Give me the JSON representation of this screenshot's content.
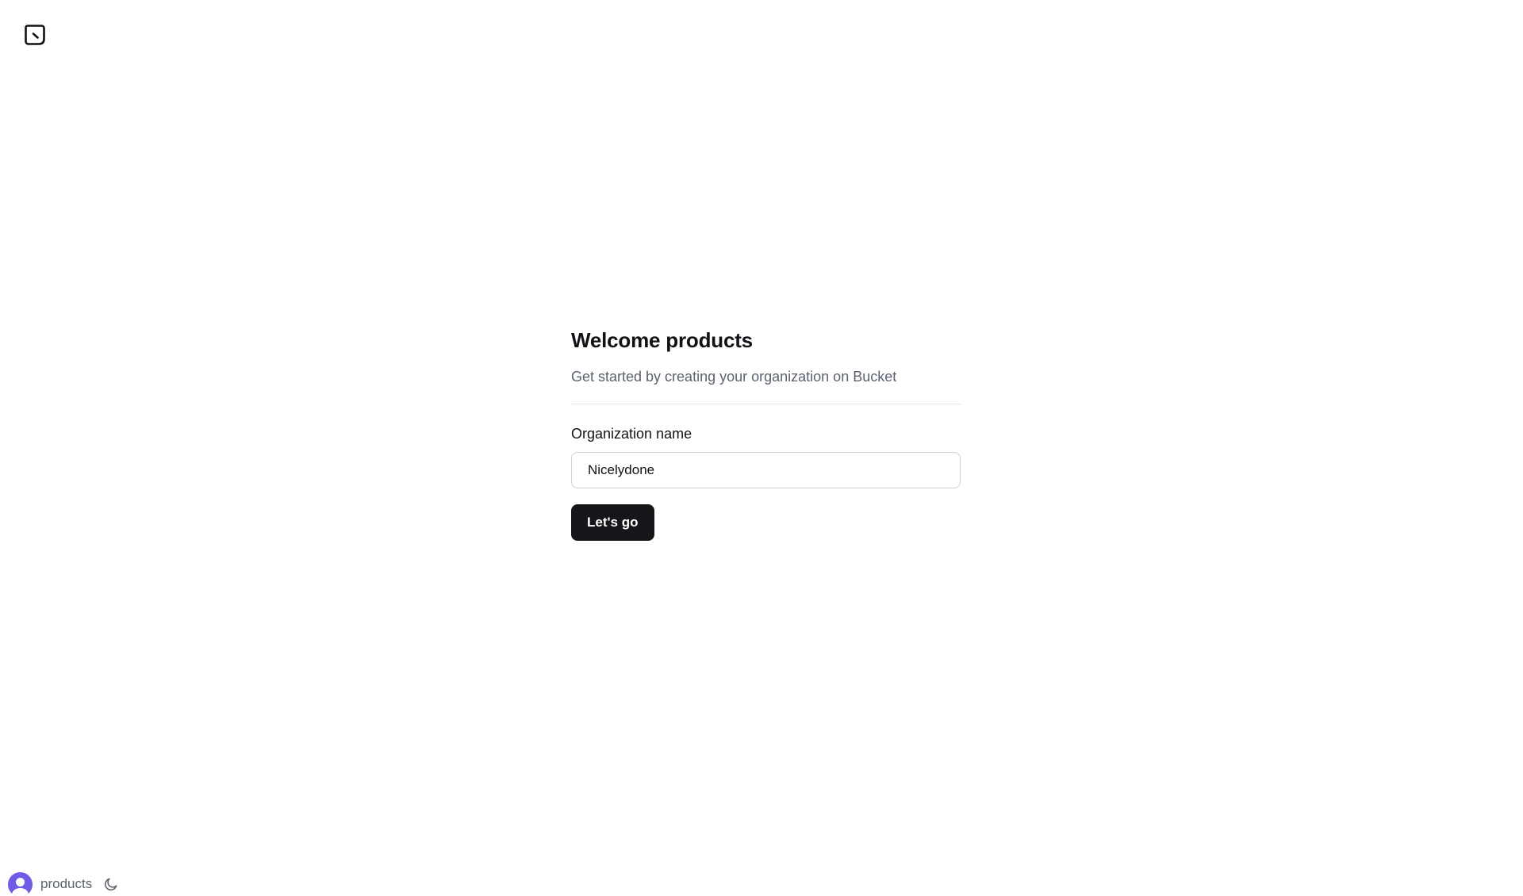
{
  "app": {
    "logo_icon": "bucket-logo-icon"
  },
  "onboarding": {
    "title": "Welcome products",
    "subtitle": "Get started by creating your organization on Bucket",
    "org_field": {
      "label": "Organization name",
      "value": "Nicelydone"
    },
    "submit_label": "Let's go"
  },
  "footer": {
    "avatar_icon": "user-avatar-icon",
    "username": "products",
    "theme_toggle_icon": "moon-icon"
  },
  "colors": {
    "primary_button": "#15161a",
    "avatar": "#6e5ce6",
    "muted_text": "#5c6170"
  }
}
